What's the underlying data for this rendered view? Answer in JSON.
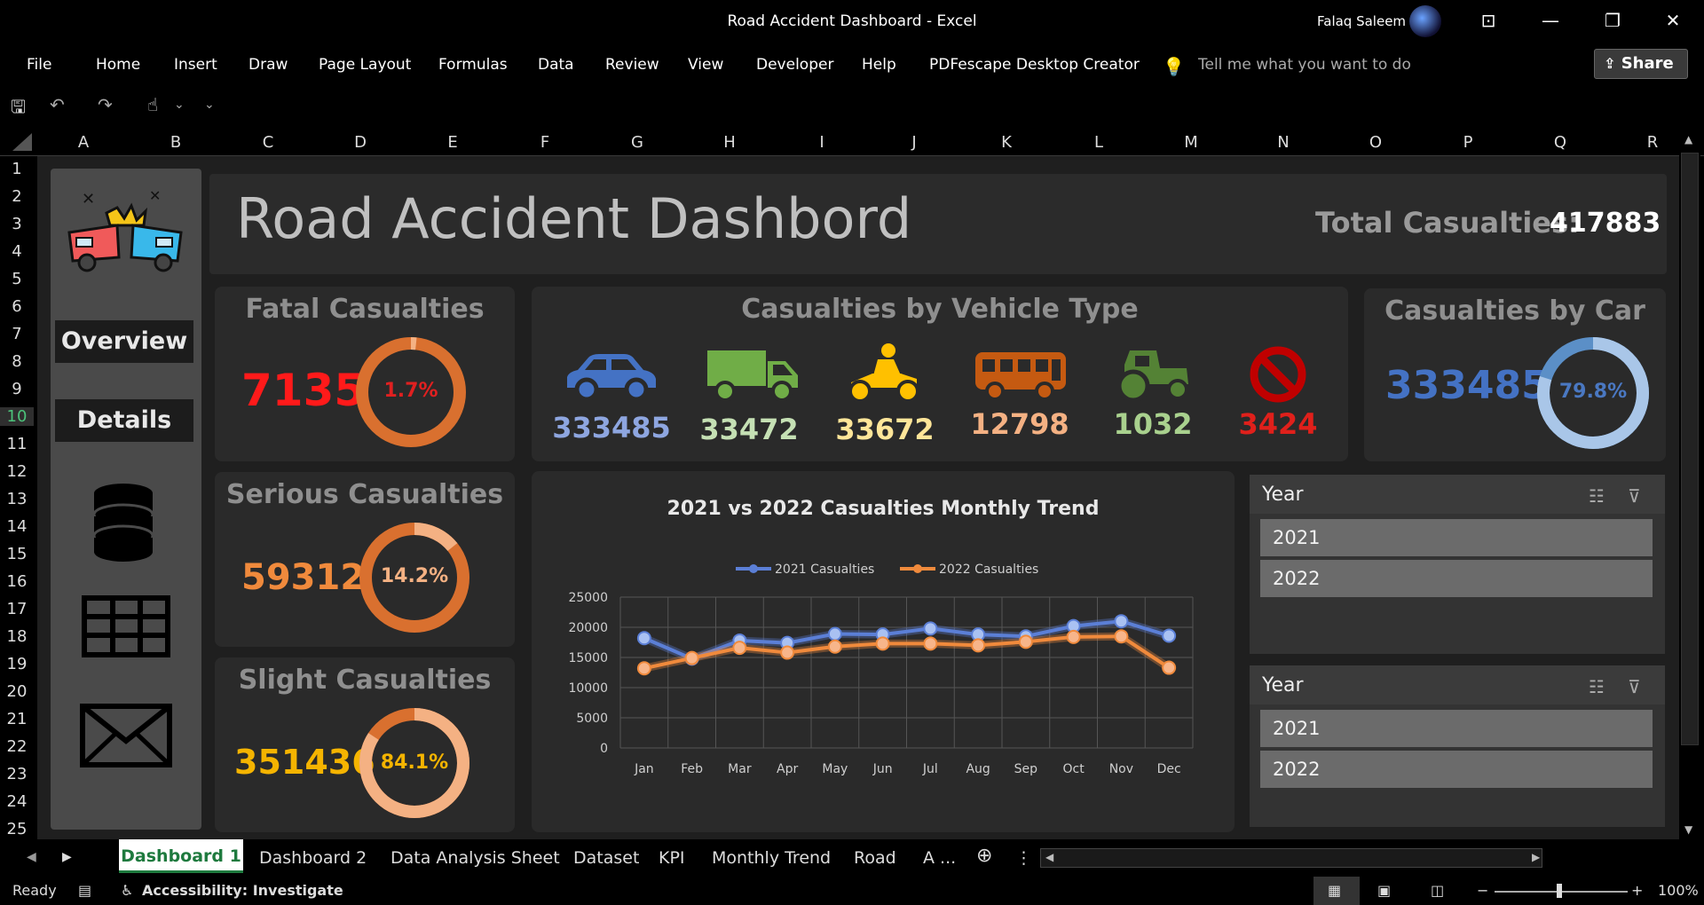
{
  "window": {
    "title": "Road Accident Dashboard  -  Excel",
    "user": "Falaq Saleem"
  },
  "ribbon": {
    "tabs": [
      "File",
      "Home",
      "Insert",
      "Draw",
      "Page Layout",
      "Formulas",
      "Data",
      "Review",
      "View",
      "Developer",
      "Help",
      "PDFescape Desktop Creator"
    ],
    "tell_me": "Tell me what you want to do",
    "share": "Share"
  },
  "grid": {
    "columns": [
      "A",
      "B",
      "C",
      "D",
      "E",
      "F",
      "G",
      "H",
      "I",
      "J",
      "K",
      "L",
      "M",
      "N",
      "O",
      "P",
      "Q",
      "R"
    ],
    "rows": [
      "1",
      "2",
      "3",
      "4",
      "5",
      "6",
      "7",
      "8",
      "9",
      "10",
      "11",
      "12",
      "13",
      "14",
      "15",
      "16",
      "17",
      "18",
      "19",
      "20",
      "21",
      "22",
      "23",
      "24",
      "25"
    ],
    "selected_row": "10"
  },
  "sidebar": {
    "overview": "Overview",
    "details": "Details",
    "icons": [
      "crash-icon",
      "database-icon",
      "table-icon",
      "mail-icon"
    ]
  },
  "header": {
    "title": "Road Accident Dashbord",
    "total_label": "Total Casualties:",
    "total_value": "417883"
  },
  "fatal": {
    "title": "Fatal Casualties",
    "value": "7135",
    "pct": "1.7%",
    "pct_num": 1.7,
    "color": "#ff1a1a"
  },
  "serious": {
    "title": "Serious  Casualties",
    "value": "59312",
    "pct": "14.2%",
    "pct_num": 14.2,
    "color": "#f08a3c"
  },
  "slight": {
    "title": "Slight Casualties",
    "value": "351436",
    "pct": "84.1%",
    "pct_num": 84.1,
    "color": "#f5b400"
  },
  "vehicle": {
    "title": "Casualties by Vehicle Type",
    "items": [
      {
        "icon": "car-icon",
        "value": "333485",
        "color": "#8ea6e0"
      },
      {
        "icon": "truck-icon",
        "value": "33472",
        "color": "#c5e0b4"
      },
      {
        "icon": "motorbike-icon",
        "value": "33672",
        "color": "#ffe699"
      },
      {
        "icon": "bus-icon",
        "value": "12798",
        "color": "#f4b183"
      },
      {
        "icon": "tractor-icon",
        "value": "1032",
        "color": "#a9d18e"
      },
      {
        "icon": "prohibited-icon",
        "value": "3424",
        "color": "#e0201b"
      }
    ]
  },
  "car": {
    "title": "Casualties by Car",
    "value": "333485",
    "pct": "79.8%",
    "pct_num": 79.8
  },
  "chart_data": {
    "type": "line",
    "title": "2021 vs 2022 Casualties Monthly Trend",
    "categories": [
      "Jan",
      "Feb",
      "Mar",
      "Apr",
      "May",
      "Jun",
      "Jul",
      "Aug",
      "Sep",
      "Oct",
      "Nov",
      "Dec"
    ],
    "series": [
      {
        "name": "2021 Casualties",
        "color": "#5b7fd6",
        "values": [
          18200,
          14800,
          17800,
          17400,
          18900,
          18800,
          19800,
          18800,
          18500,
          20200,
          21000,
          18600
        ]
      },
      {
        "name": "2022 Casualties",
        "color": "#f08a3c",
        "values": [
          13200,
          14900,
          16600,
          15800,
          16800,
          17300,
          17300,
          17000,
          17600,
          18400,
          18500,
          13300
        ]
      }
    ],
    "ylim": [
      0,
      25000
    ],
    "yticks": [
      "25000",
      "20000",
      "15000",
      "10000",
      "5000",
      "0"
    ],
    "grid": true,
    "legend": "top"
  },
  "slicer1": {
    "title": "Year",
    "items": [
      "2021",
      "2022"
    ]
  },
  "slicer2": {
    "title": "Year",
    "items": [
      "2021",
      "2022"
    ]
  },
  "sheets": {
    "active": "Dashboard 1",
    "tabs": [
      "Dashboard 2",
      "Data Analysis Sheet",
      "Dataset",
      "KPI",
      "Monthly Trend",
      "Road",
      "A ..."
    ]
  },
  "status": {
    "ready": "Ready",
    "accessibility": "Accessibility: Investigate",
    "zoom": "100%"
  }
}
